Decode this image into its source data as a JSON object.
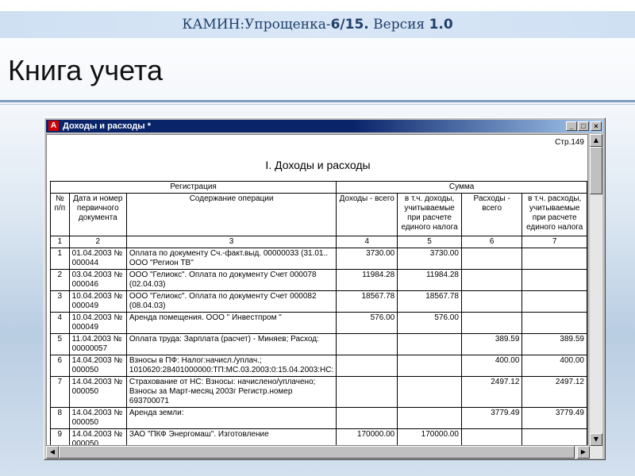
{
  "banner": {
    "part1": "КАМИН:",
    "part2": "Упрощенка-",
    "part3": "6/15.",
    "part4": " Версия ",
    "part5": "1.0"
  },
  "page_title": "Книга учета",
  "window": {
    "title": "Доходы и расходы *",
    "icon": "app-logo-icon",
    "buttons": {
      "minimize": "_",
      "maximize": "□",
      "close": "×"
    }
  },
  "report": {
    "page_label": "Стр.149",
    "section_title": "I. Доходы и расходы",
    "group_headers": {
      "registration": "Регистрация",
      "sum": "Сумма"
    },
    "column_headers": [
      "№ п/п",
      "Дата и номер первичного документа",
      "Содержание операции",
      "Доходы - всего",
      "в т.ч. доходы, учитываемые при расчете единого налога",
      "Расходы - всего",
      "в т.ч. расходы, учитываемые при расчете единого налога"
    ],
    "column_numbers": [
      "1",
      "2",
      "3",
      "4",
      "5",
      "6",
      "7"
    ],
    "rows": [
      {
        "n": "1",
        "doc": "01.04.2003 № 000044",
        "desc": "Оплата по документу Сч.-факт.выд. 00000033 (31.01.. ООО \"Регион ТВ\"",
        "inc": "3730.00",
        "inc_tax": "3730.00",
        "exp": "",
        "exp_tax": ""
      },
      {
        "n": "2",
        "doc": "03.04.2003 № 000046",
        "desc": "ООО \"Гелиокс\". Оплата по документу Счет 000078 (02.04.03)",
        "inc": "11984.28",
        "inc_tax": "11984.28",
        "exp": "",
        "exp_tax": ""
      },
      {
        "n": "3",
        "doc": "10.04.2003 № 000049",
        "desc": "ООО \"Гелиокс\". Оплата по документу Счет 000082 (08.04.03)",
        "inc": "18567.78",
        "inc_tax": "18567.78",
        "exp": "",
        "exp_tax": ""
      },
      {
        "n": "4",
        "doc": "10.04.2003 № 000049",
        "desc": "Аренда помещения. ООО \" Инвестпром \"",
        "inc": "576.00",
        "inc_tax": "576.00",
        "exp": "",
        "exp_tax": ""
      },
      {
        "n": "5",
        "doc": "11.04.2003 № 00000057",
        "desc": "Оплата труда: Зарплата (расчет) - Миняев; Расход:",
        "inc": "",
        "inc_tax": "",
        "exp": "389.59",
        "exp_tax": "389.59"
      },
      {
        "n": "6",
        "doc": "14.04.2003 № 000050",
        "desc": "Взносы в ПФ: Налог:начисл./уплач.; 1010620:28401000000:ТП:МС.03.2003:0:15.04.2003:НС:",
        "inc": "",
        "inc_tax": "",
        "exp": "400.00",
        "exp_tax": "400.00"
      },
      {
        "n": "7",
        "doc": "14.04.2003 № 000050",
        "desc": "Страхование от НС: Взносы: начислено/уплачено; Взносы за Март-месяц 2003г Регистр.номер 693700071",
        "inc": "",
        "inc_tax": "",
        "exp": "2497.12",
        "exp_tax": "2497.12"
      },
      {
        "n": "8",
        "doc": "14.04.2003 № 000050",
        "desc": "Аренда земли:",
        "inc": "",
        "inc_tax": "",
        "exp": "3779.49",
        "exp_tax": "3779.49"
      },
      {
        "n": "9",
        "doc": "14.04.2003 № 000050",
        "desc": "ЗАО \"ПКФ Энергомаш\". Изготовление",
        "inc": "170000.00",
        "inc_tax": "170000.00",
        "exp": "",
        "exp_tax": ""
      }
    ]
  },
  "colors": {
    "banner_bg": "#d9e7f6",
    "banner_text": "#1f3f6a",
    "titlebar": "#0a246a",
    "window_face": "#c0c0c0"
  }
}
